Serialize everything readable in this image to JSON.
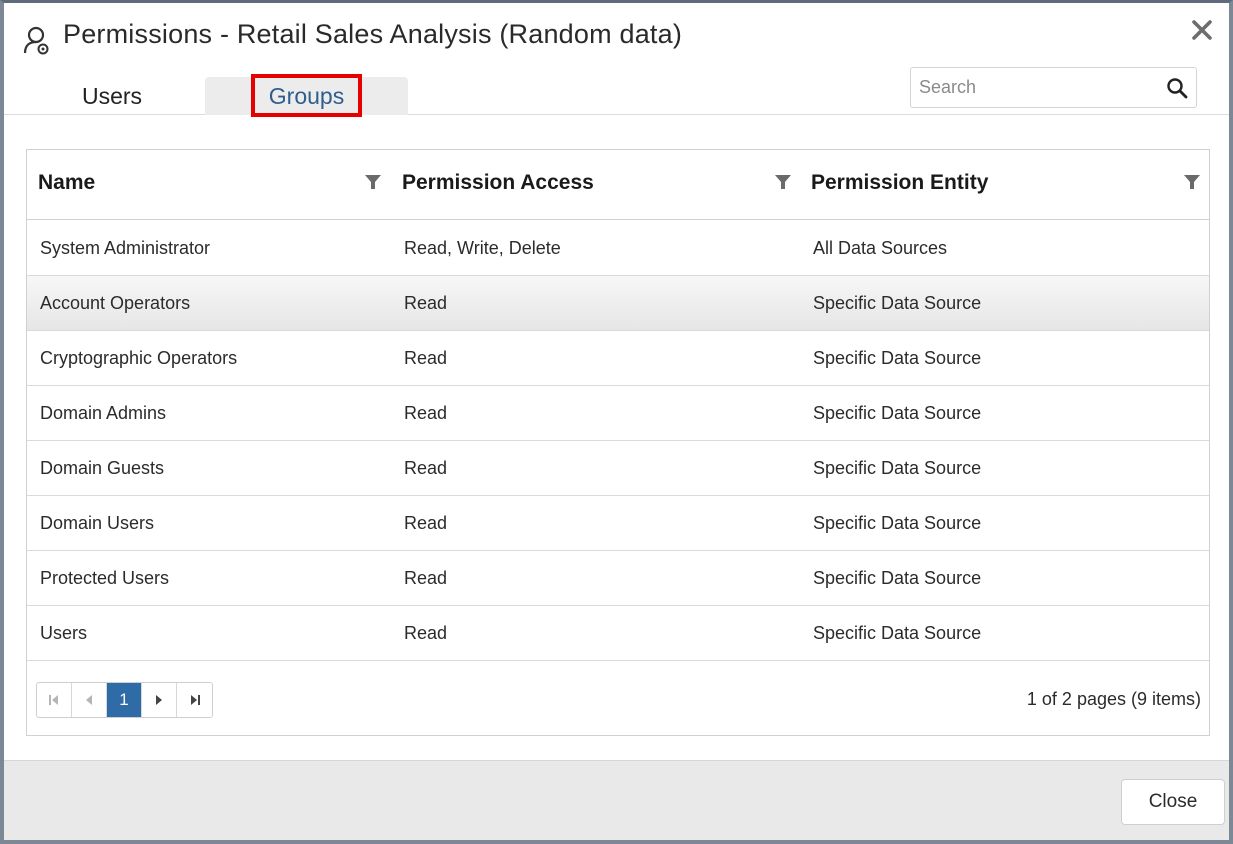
{
  "dialog": {
    "title": "Permissions - Retail Sales Analysis (Random data)",
    "title_icon": "user-permission-icon",
    "close_icon": "close-icon"
  },
  "tabs": [
    {
      "label": "Users",
      "active": false
    },
    {
      "label": "Groups",
      "active": true
    }
  ],
  "search": {
    "placeholder": "Search",
    "value": "",
    "icon": "search-icon"
  },
  "grid": {
    "columns": [
      "Name",
      "Permission Access",
      "Permission Entity"
    ],
    "filter_icon": "filter-icon",
    "rows": [
      {
        "name": "System Administrator",
        "access": "Read, Write, Delete",
        "entity": "All Data Sources"
      },
      {
        "name": "Account Operators",
        "access": "Read",
        "entity": "Specific Data Source"
      },
      {
        "name": "Cryptographic Operators",
        "access": "Read",
        "entity": "Specific Data Source"
      },
      {
        "name": "Domain Admins",
        "access": "Read",
        "entity": "Specific Data Source"
      },
      {
        "name": "Domain Guests",
        "access": "Read",
        "entity": "Specific Data Source"
      },
      {
        "name": "Domain Users",
        "access": "Read",
        "entity": "Specific Data Source"
      },
      {
        "name": "Protected Users",
        "access": "Read",
        "entity": "Specific Data Source"
      },
      {
        "name": "Users",
        "access": "Read",
        "entity": "Specific Data Source"
      }
    ],
    "selected_row": 1
  },
  "pager": {
    "current_page": "1",
    "info": "1 of 2 pages (9 items)"
  },
  "footer": {
    "close_label": "Close"
  },
  "colors": {
    "accent": "#2f6ba6",
    "active_tab_text": "#2f5e8c",
    "highlight_box": "#e60000",
    "footer_bg": "#e9e9e9"
  }
}
